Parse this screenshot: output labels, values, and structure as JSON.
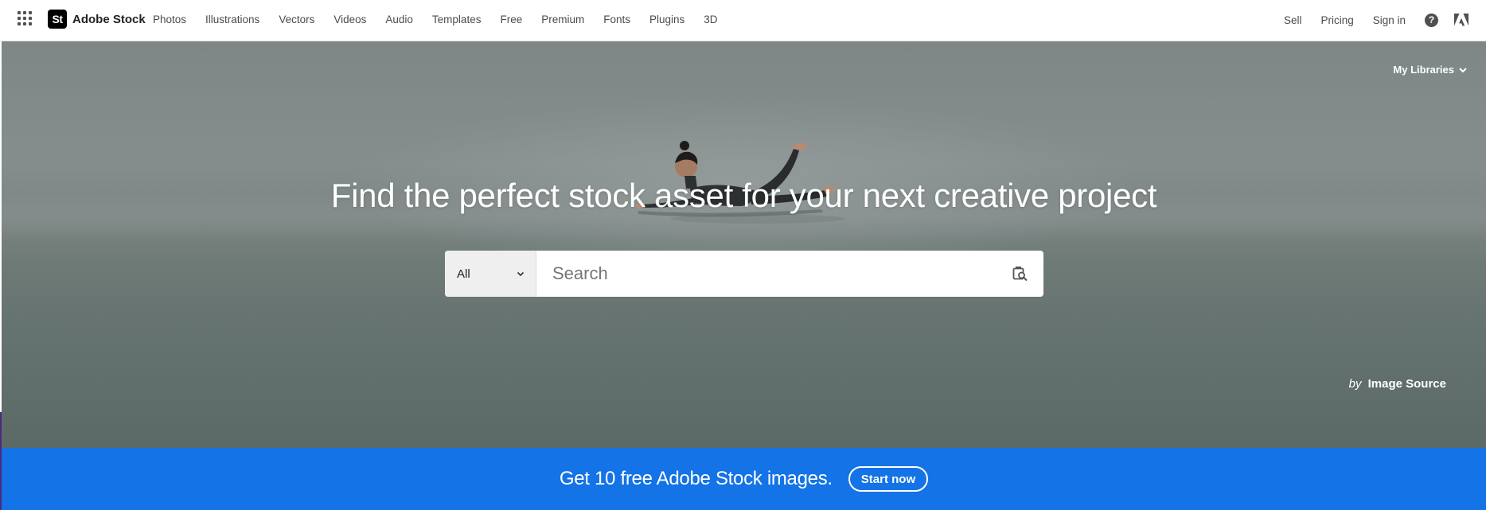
{
  "brand": {
    "logo_text": "St",
    "name": "Adobe Stock"
  },
  "nav": {
    "main": [
      "Photos",
      "Illustrations",
      "Vectors",
      "Videos",
      "Audio",
      "Templates",
      "Free",
      "Premium",
      "Fonts",
      "Plugins",
      "3D"
    ],
    "sell": "Sell",
    "pricing": "Pricing",
    "sign_in": "Sign in",
    "help_glyph": "?"
  },
  "icons": {
    "apps": "apps-grid-icon",
    "help": "help-icon",
    "adobe": "adobe-logo-icon",
    "dropdown": "chevron-down-icon",
    "visual_search": "visual-search-icon"
  },
  "hero": {
    "my_libraries": "My Libraries",
    "title": "Find the perfect stock asset for your next creative project",
    "search": {
      "type_selected": "All",
      "placeholder": "Search",
      "value": ""
    },
    "credit_by": "by",
    "credit_source": "Image Source"
  },
  "promo": {
    "text": "Get 10 free Adobe Stock images.",
    "button": "Start now"
  },
  "colors": {
    "promo_blue": "#1473e6",
    "nav_text": "#4b4b4b",
    "logo_bg": "#000000"
  }
}
